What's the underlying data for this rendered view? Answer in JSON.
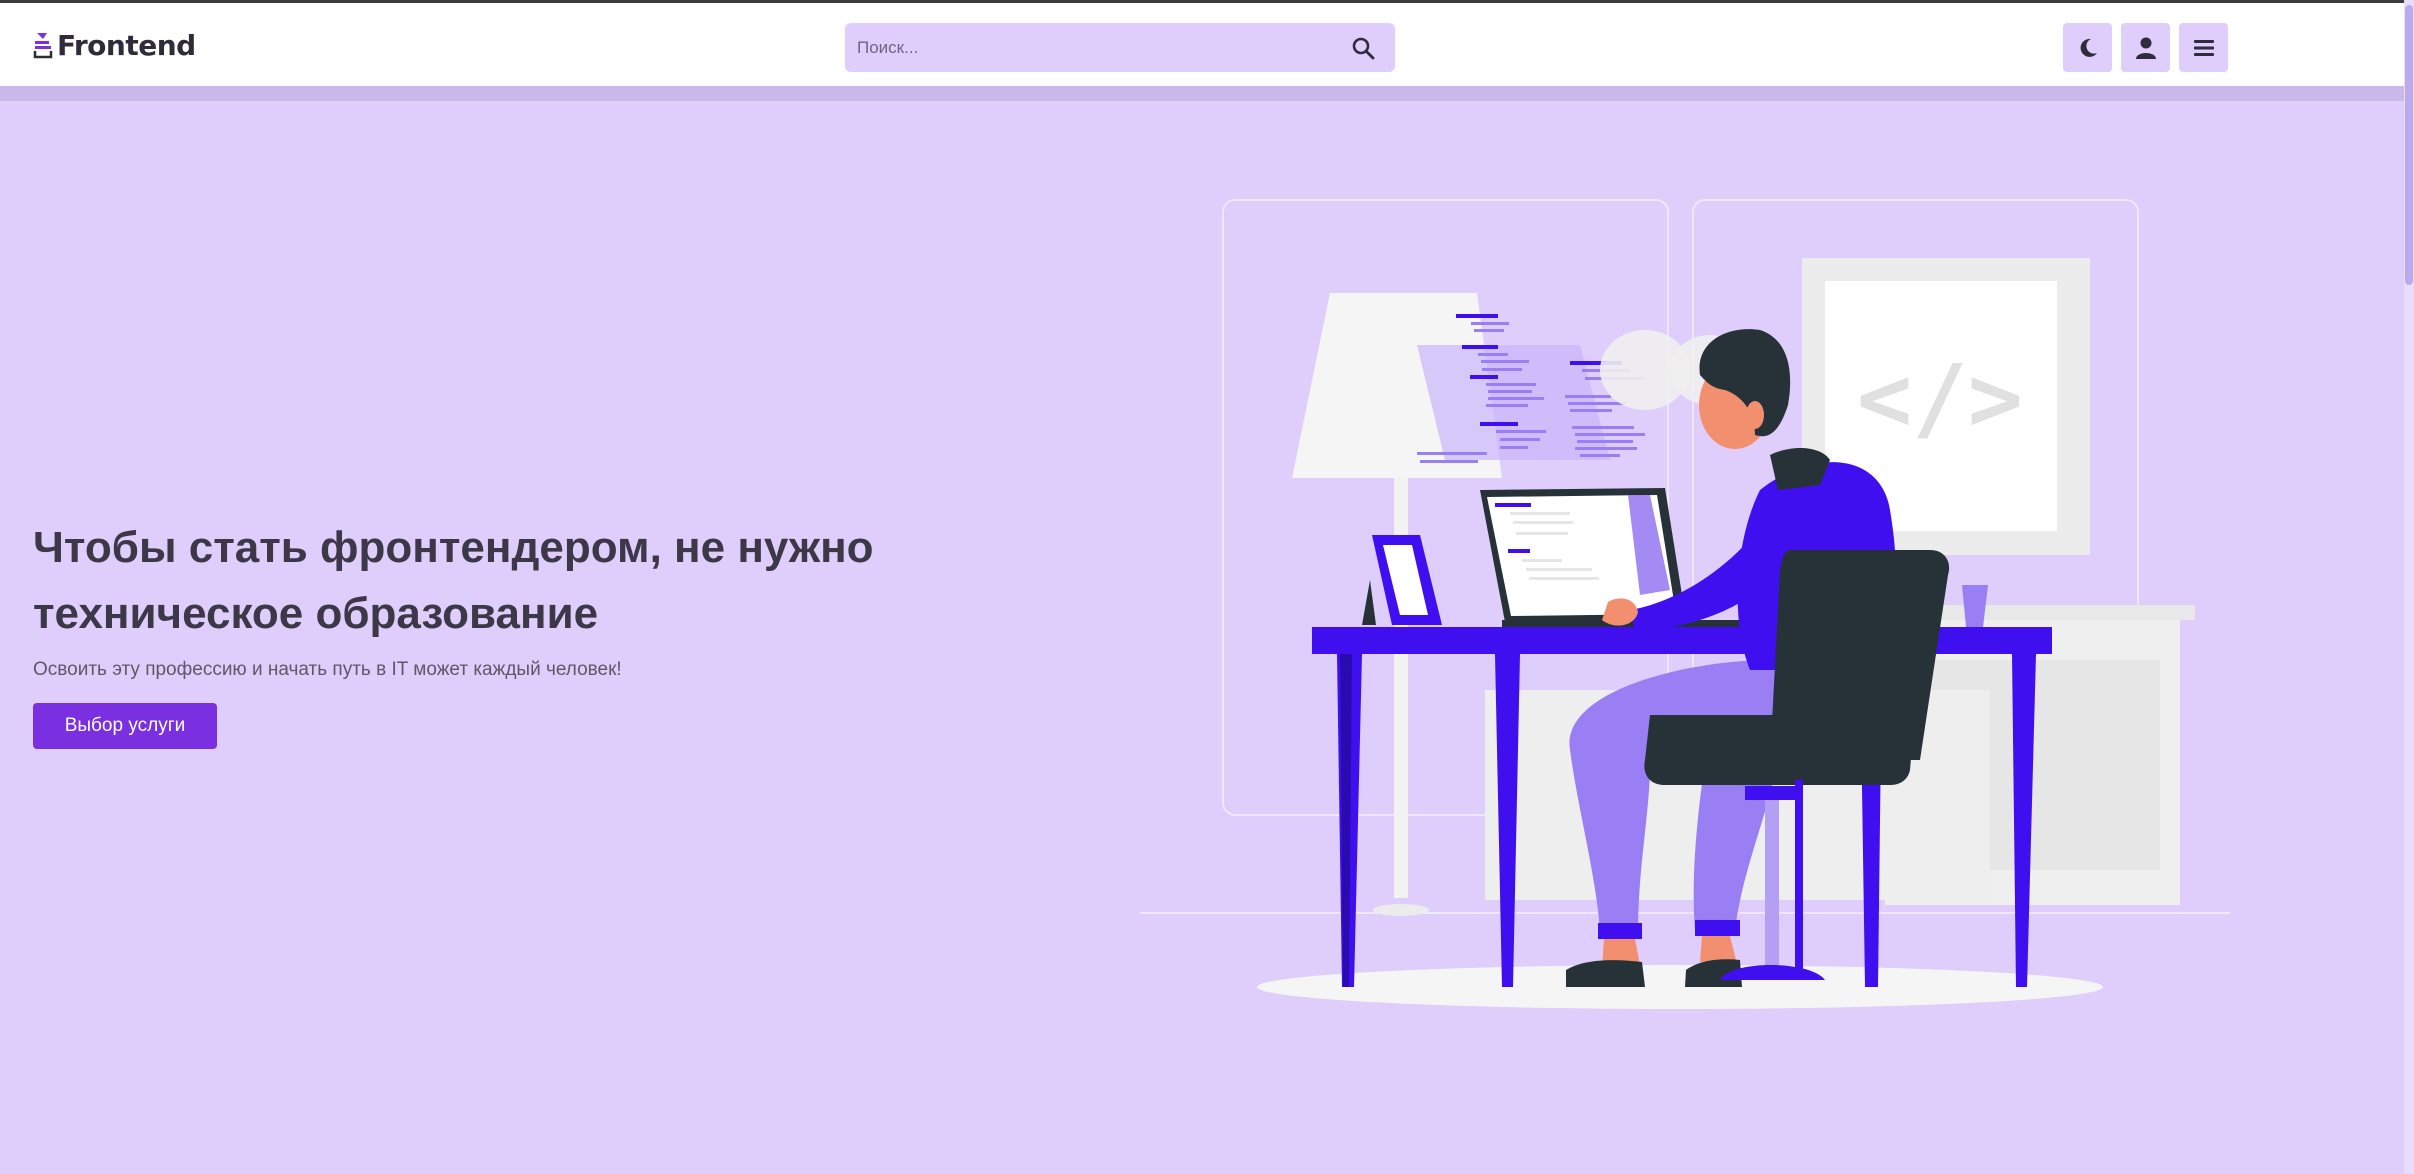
{
  "header": {
    "logo_text": "Frontend",
    "search_placeholder": "Поиск...",
    "buttons": [
      "theme-toggle",
      "account",
      "menu"
    ]
  },
  "hero": {
    "title_line1": "Чтобы стать фронтендером, не нужно",
    "title_line2": "техническое образование",
    "subtitle": "Освоить эту профессию и начать путь в IT может каждый человек!",
    "cta_label": "Выбор услуги",
    "illustration_code_symbol": "</>"
  },
  "colors": {
    "page_bg": "#dfcdfc",
    "header_bg": "#ffffff",
    "accent": "#7a2fe0",
    "illustration_blue": "#3f0ff0",
    "illustration_purple": "#9a7ef3",
    "dark": "#263238"
  },
  "icons": [
    "logo-icon",
    "search-icon",
    "moon-icon",
    "user-icon",
    "hamburger-icon"
  ]
}
